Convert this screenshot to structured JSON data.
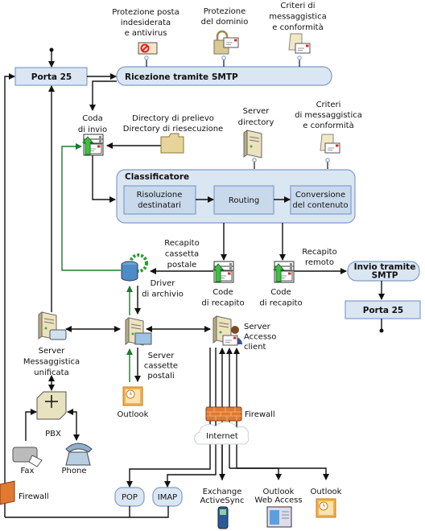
{
  "labels": {
    "porta25_top": [
      "Porta 25"
    ],
    "smtp_receive": [
      "Ricezione tramite SMTP"
    ],
    "antispam": [
      "Protezione posta",
      "indesiderata",
      "e antivirus"
    ],
    "domain_protection": [
      "Protezione",
      "del dominio"
    ],
    "policy_top": [
      "Criteri di",
      "messaggistica",
      "e conformità"
    ],
    "submission_queue": [
      "Coda",
      "di invio"
    ],
    "pickup_dirs": [
      "Directory di prelievo",
      "Directory di riesecuzione"
    ],
    "directory_server": [
      "Server",
      "directory"
    ],
    "policy_mid": [
      "Criteri",
      "di messaggistica",
      "e conformità"
    ],
    "categorizer": [
      "Classificatore"
    ],
    "recipient_resolution": [
      "Risoluzione",
      "destinatari"
    ],
    "routing": [
      "Routing"
    ],
    "content_conversion": [
      "Conversione",
      "del contenuto"
    ],
    "mailbox_delivery": [
      "Recapito",
      "cassetta",
      "postale"
    ],
    "remote_delivery": [
      "Recapito",
      "remoto"
    ],
    "delivery_queue_1": [
      "Code",
      "di recapito"
    ],
    "delivery_queue_2": [
      "Code",
      "di recapito"
    ],
    "smtp_send": [
      "Invio tramite",
      "SMTP"
    ],
    "porta25_bottom": [
      "Porta 25"
    ],
    "store_driver": [
      "Driver",
      "di archivio"
    ],
    "um_server": [
      "Server",
      "Messaggistica",
      "unificata"
    ],
    "mailbox_server": [
      "Server",
      "cassette",
      "postali"
    ],
    "cas_server": [
      "Server",
      "Accesso",
      "client"
    ],
    "outlook_internal": [
      "Outlook"
    ],
    "pbx": [
      "PBX"
    ],
    "fax": [
      "Fax"
    ],
    "phone": [
      "Phone"
    ],
    "firewall_left": [
      "Firewall"
    ],
    "firewall_right": [
      "Firewall"
    ],
    "internet": [
      "Internet"
    ],
    "pop": [
      "POP"
    ],
    "imap": [
      "IMAP"
    ],
    "activesync": [
      "Exchange",
      "ActiveSync"
    ],
    "owa": [
      "Outlook",
      "Web Access"
    ],
    "outlook_external": [
      "Outlook"
    ]
  },
  "colors": {
    "box_fill": "#dbe6f3",
    "box_stroke": "#7e9ccc",
    "green_flow": "#1e7a2e",
    "firewall": "#e07a30"
  }
}
